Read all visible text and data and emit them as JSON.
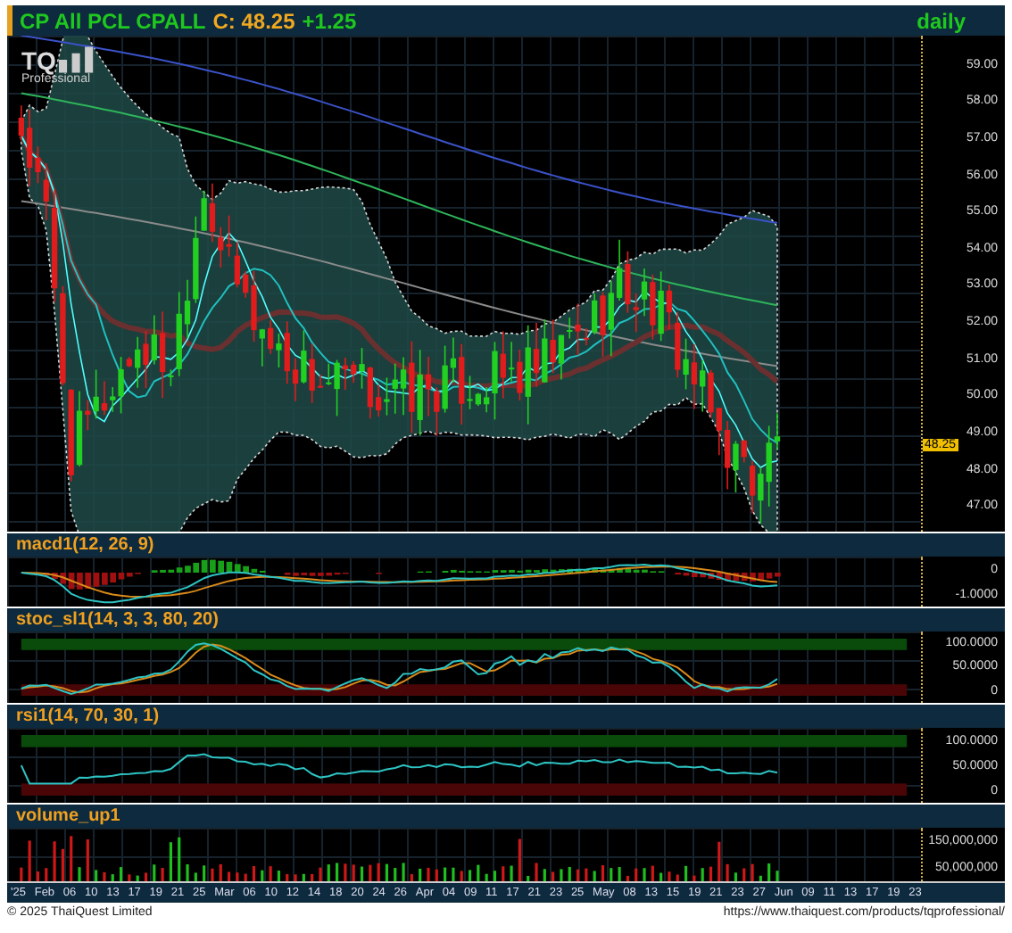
{
  "header": {
    "name": "CP All PCL CPALL",
    "close": "C: 48.25",
    "change": "+1.25",
    "period": "daily"
  },
  "logo": {
    "mark": "TQ",
    "caption": "Professional"
  },
  "price_axis": {
    "ticks": [
      "59.00",
      "58.00",
      "57.00",
      "56.00",
      "55.00",
      "54.00",
      "53.00",
      "52.00",
      "51.00",
      "50.00",
      "49.00",
      "48.00",
      "47.00"
    ],
    "marker": "48.25"
  },
  "panels": [
    {
      "kind": "macd",
      "title": "macd1(12, 26, 9)",
      "ticks": [
        "0",
        "-1.0000"
      ]
    },
    {
      "kind": "stoch",
      "title": "stoc_sl1(14, 3, 3, 80, 20)",
      "ticks": [
        "100.0000",
        "50.0000",
        "0"
      ]
    },
    {
      "kind": "rsi",
      "title": "rsi1(14, 70, 30, 1)",
      "ticks": [
        "100.0000",
        "50.0000",
        "0"
      ]
    },
    {
      "kind": "volume",
      "title": "volume_up1",
      "ticks": [
        "150,000,000",
        "50,000,000"
      ]
    }
  ],
  "dates": [
    "'25",
    "Feb",
    "06",
    "10",
    "13",
    "17",
    "19",
    "21",
    "25",
    "Mar",
    "06",
    "10",
    "12",
    "14",
    "18",
    "20",
    "24",
    "26",
    "Apr",
    "04",
    "09",
    "11",
    "17",
    "21",
    "23",
    "25",
    "May",
    "08",
    "13",
    "15",
    "19",
    "21",
    "23",
    "27",
    "Jun",
    "09",
    "11",
    "13",
    "17",
    "19",
    "23"
  ],
  "footer": {
    "copyright": "© 2025 ThaiQuest Limited",
    "url": "https://www.thaiquest.com/products/tqprofessional/"
  }
}
